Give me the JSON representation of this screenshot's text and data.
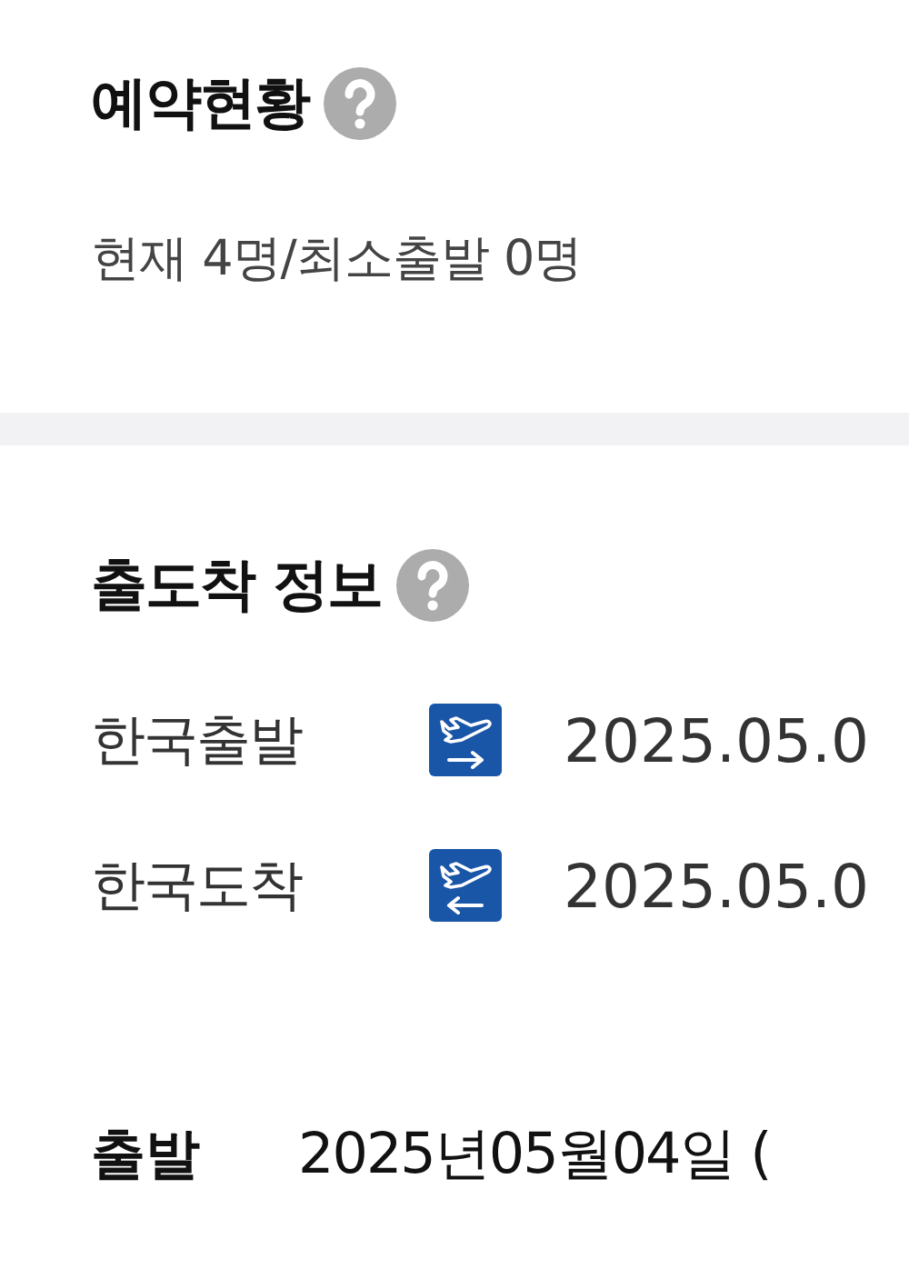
{
  "booking_status": {
    "title": "예약현황",
    "summary": "현재 4명/최소출발 0명"
  },
  "schedule": {
    "title": "출도착 정보",
    "rows": [
      {
        "label": "한국출발",
        "kind": "departure",
        "value": "2025.05.0"
      },
      {
        "label": "한국도착",
        "kind": "arrival",
        "value": "2025.05.0"
      }
    ]
  },
  "departure": {
    "label": "출발",
    "value": "2025년05월04일 ("
  }
}
